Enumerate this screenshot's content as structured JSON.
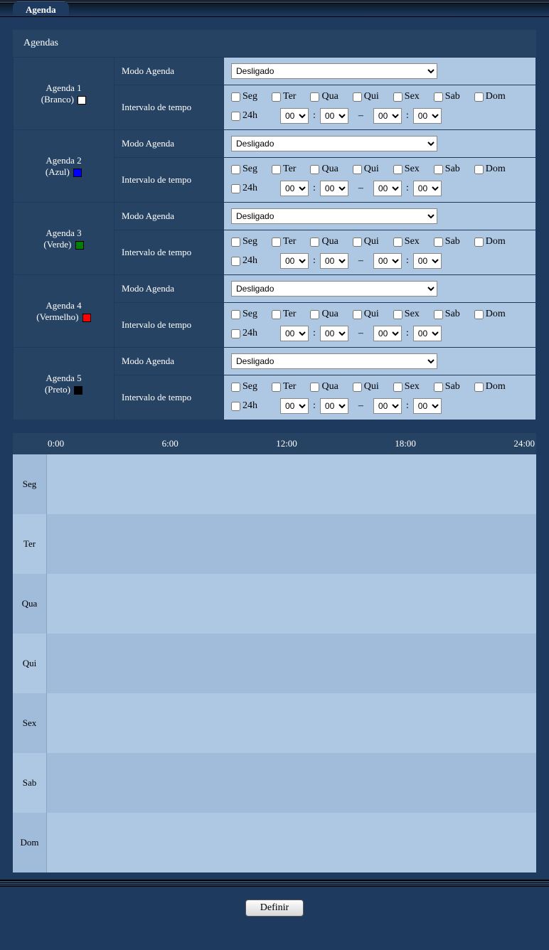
{
  "tab": {
    "label": "Agenda"
  },
  "panel_title": "Agendas",
  "labels": {
    "modo": "Modo Agenda",
    "intervalo": "Intervalo de tempo",
    "h24": "24h",
    "definir": "Definir"
  },
  "days": [
    "Seg",
    "Ter",
    "Qua",
    "Qui",
    "Sex",
    "Sab",
    "Dom"
  ],
  "time_ticks": [
    "0:00",
    "6:00",
    "12:00",
    "18:00",
    "24:00"
  ],
  "time_opt": "00",
  "agendas": [
    {
      "name_line1": "Agenda 1",
      "name_line2": "(Branco)",
      "swatch": "#ffffff",
      "mode": "Desligado"
    },
    {
      "name_line1": "Agenda 2",
      "name_line2": "(Azul)",
      "swatch": "#0000ff",
      "mode": "Desligado"
    },
    {
      "name_line1": "Agenda 3",
      "name_line2": "(Verde)",
      "swatch": "#008000",
      "mode": "Desligado"
    },
    {
      "name_line1": "Agenda 4",
      "name_line2": "(Vermelho)",
      "swatch": "#ff0000",
      "mode": "Desligado"
    },
    {
      "name_line1": "Agenda 5",
      "name_line2": "(Preto)",
      "swatch": "#000000",
      "mode": "Desligado"
    }
  ]
}
